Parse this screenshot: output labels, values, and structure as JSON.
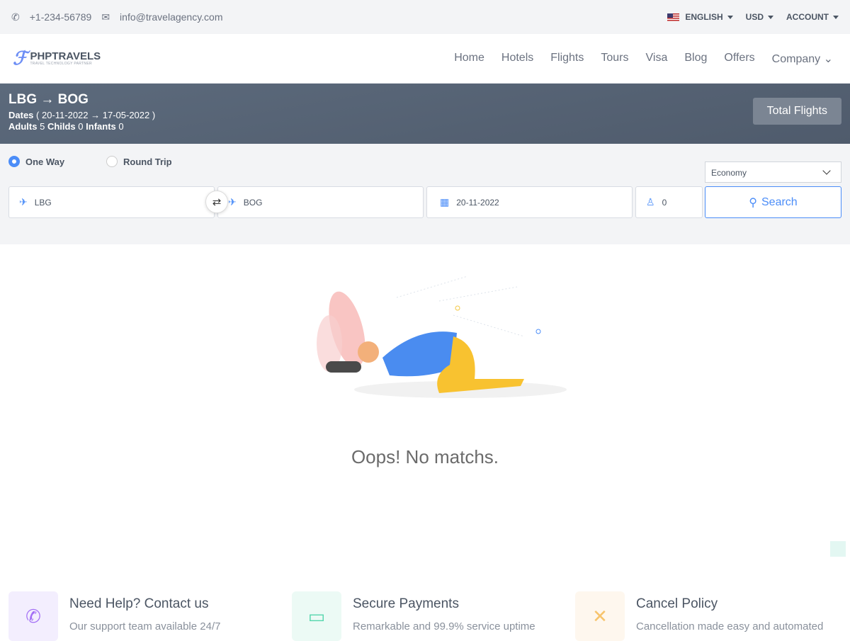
{
  "topbar": {
    "phone": "+1-234-56789",
    "email": "info@travelagency.com",
    "language": "ENGLISH",
    "currency": "USD",
    "account": "ACCOUNT"
  },
  "brand": {
    "name": "PHPTRAVELS",
    "tagline": "TRAVEL TECHNOLOGY PARTNER"
  },
  "nav": [
    "Home",
    "Hotels",
    "Flights",
    "Tours",
    "Visa",
    "Blog",
    "Offers",
    "Company"
  ],
  "hero": {
    "from": "LBG",
    "to": "BOG",
    "dates_label": "Dates",
    "dates": "( 20-11-2022 → 17-05-2022 )",
    "adults_label": "Adults",
    "adults": "5",
    "childs_label": "Childs",
    "childs": "0",
    "infants_label": "Infants",
    "infants": "0",
    "total_flights": "Total Flights"
  },
  "search": {
    "one_way": "One Way",
    "round_trip": "Round Trip",
    "trip_type": "one_way",
    "cabin": "Economy",
    "from": "LBG",
    "to": "BOG",
    "date": "20-11-2022",
    "travellers": "0",
    "button": "Search"
  },
  "empty": {
    "message": "Oops! No matchs."
  },
  "features": [
    {
      "title": "Need Help? Contact us",
      "text": "Our support team available 24/7",
      "icon": "phone-icon",
      "color": "#a36ff5",
      "bg": "#f3eefe"
    },
    {
      "title": "Secure Payments",
      "text": "Remarkable and 99.9% service uptime",
      "icon": "money-icon",
      "color": "#55d6ad",
      "bg": "#ecfaf5"
    },
    {
      "title": "Cancel Policy",
      "text": "Cancellation made easy and automated",
      "icon": "close-icon",
      "color": "#f7c46c",
      "bg": "#fef7ee"
    }
  ]
}
